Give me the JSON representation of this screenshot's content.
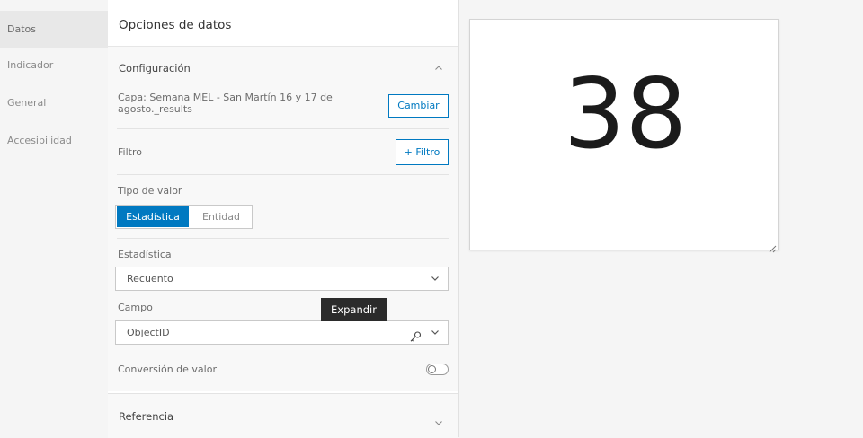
{
  "nav": {
    "items": [
      {
        "label": "Datos",
        "active": true
      },
      {
        "label": "Indicador",
        "active": false
      },
      {
        "label": "General",
        "active": false
      },
      {
        "label": "Accesibilidad",
        "active": false
      }
    ]
  },
  "panel": {
    "title": "Opciones de datos",
    "config": {
      "heading": "Configuración",
      "layer_label": "Capa: Semana MEL - San Martín 16 y 17 de",
      "layer_label_2": "agosto._results",
      "change_button": "Cambiar",
      "filter_label": "Filtro",
      "filter_button": "+ Filtro",
      "value_type_label": "Tipo de valor",
      "value_type_options": [
        "Estadística",
        "Entidad"
      ],
      "value_type_selected": "Estadística",
      "statistic_label": "Estadística",
      "statistic_value": "Recuento",
      "field_label": "Campo",
      "field_value": "ObjectID",
      "tooltip": "Expandir",
      "conversion_label": "Conversión de valor",
      "conversion_on": false
    },
    "reference_heading": "Referencia"
  },
  "preview": {
    "value": "38"
  },
  "icons": [
    "chevron-up-icon",
    "chevron-down-icon",
    "key-icon",
    "resize-handle-icon"
  ],
  "colors": {
    "accent": "#0079c1"
  }
}
